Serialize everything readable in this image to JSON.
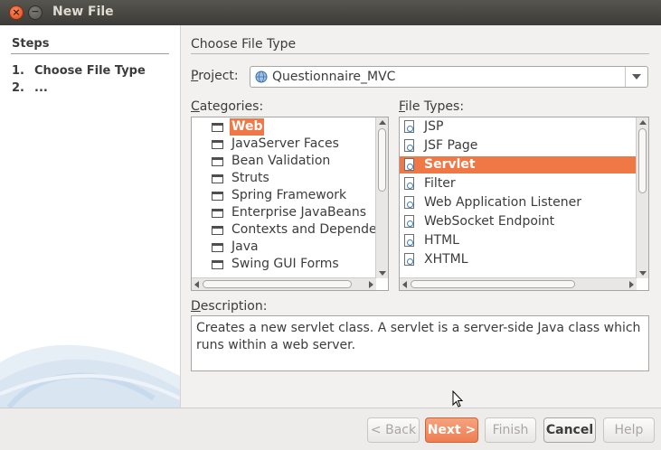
{
  "window": {
    "title": "New File"
  },
  "steps": {
    "heading": "Steps",
    "items": [
      {
        "num": "1.",
        "label": "Choose File Type"
      },
      {
        "num": "2.",
        "label": "..."
      }
    ]
  },
  "main": {
    "section_title": "Choose File Type",
    "project_label_mnemonic": "P",
    "project_label_rest": "roject:",
    "project_value": "Questionnaire_MVC",
    "categories_label_mnemonic": "C",
    "categories_label_rest": "ategories:",
    "file_types_label_mnemonic": "F",
    "file_types_label_rest": "ile Types:",
    "description_label_mnemonic": "D",
    "description_label_rest": "escription:",
    "description_text": "Creates a new servlet class. A servlet is a server-side Java class which runs within a web server."
  },
  "categories": [
    {
      "label": "Web",
      "selected": true
    },
    {
      "label": "JavaServer Faces"
    },
    {
      "label": "Bean Validation"
    },
    {
      "label": "Struts"
    },
    {
      "label": "Spring Framework"
    },
    {
      "label": "Enterprise JavaBeans"
    },
    {
      "label": "Contexts and Depende"
    },
    {
      "label": "Java"
    },
    {
      "label": "Swing GUI Forms"
    }
  ],
  "file_types": [
    {
      "label": "JSP"
    },
    {
      "label": "JSF Page"
    },
    {
      "label": "Servlet",
      "selected": true
    },
    {
      "label": "Filter"
    },
    {
      "label": "Web Application Listener"
    },
    {
      "label": "WebSocket Endpoint"
    },
    {
      "label": "HTML"
    },
    {
      "label": "XHTML"
    }
  ],
  "buttons": {
    "back": "< Back",
    "next": "Next >",
    "finish": "Finish",
    "cancel": "Cancel",
    "help": "Help"
  },
  "colors": {
    "accent": "#f07746",
    "titlebar": "#3c3b37"
  }
}
